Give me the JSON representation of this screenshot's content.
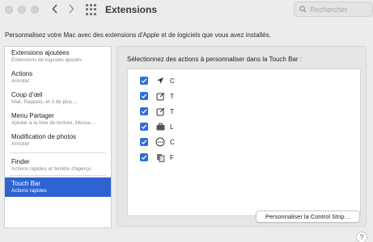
{
  "window": {
    "title": "Extensions"
  },
  "toolbar": {
    "back_icon": "chevron-left",
    "forward_icon": "chevron-right",
    "grid_icon": "show-all-grid"
  },
  "search": {
    "placeholder": "Rechercher"
  },
  "description": "Personnalisez votre Mac avec des extensions d'Apple et de logiciels que vous avez installés.",
  "sidebar": {
    "items": [
      {
        "title": "Extensions ajoutées",
        "subtitle": "Extensions de logiciels ajoutés"
      },
      {
        "title": "Actions",
        "subtitle": "Annoter"
      },
      {
        "title": "Coup d'œil",
        "subtitle": "Mail, Rappels, et 3 de plus…"
      },
      {
        "title": "Menu Partager",
        "subtitle": "Ajouter à la liste de lecture, Messa…"
      },
      {
        "title": "Modification de photos",
        "subtitle": "Annoter"
      },
      {
        "title": "Finder",
        "subtitle": "Actions rapides et fenêtre d'aperçu"
      },
      {
        "title": "Touch Bar",
        "subtitle": "Actions rapides",
        "selected": true
      }
    ]
  },
  "main": {
    "title": "Sélectionnez des actions à personnaliser dans la Touch Bar :",
    "actions": [
      {
        "label": "C",
        "icon": "location-arrow-icon",
        "checked": true
      },
      {
        "label": "T",
        "icon": "compose-icon",
        "checked": true
      },
      {
        "label": "T",
        "icon": "compose-icon",
        "checked": true
      },
      {
        "label": "L",
        "icon": "briefcase-icon",
        "checked": true
      },
      {
        "label": "C",
        "icon": "ellipsis-circle-icon",
        "checked": true
      },
      {
        "label": "F",
        "icon": "documents-icon",
        "checked": true
      }
    ],
    "control_strip_button": "Personnaliser la Control Strip…"
  },
  "help_label": "?",
  "colors": {
    "accent": "#2e63d1",
    "checkbox": "#2a6ed8"
  }
}
